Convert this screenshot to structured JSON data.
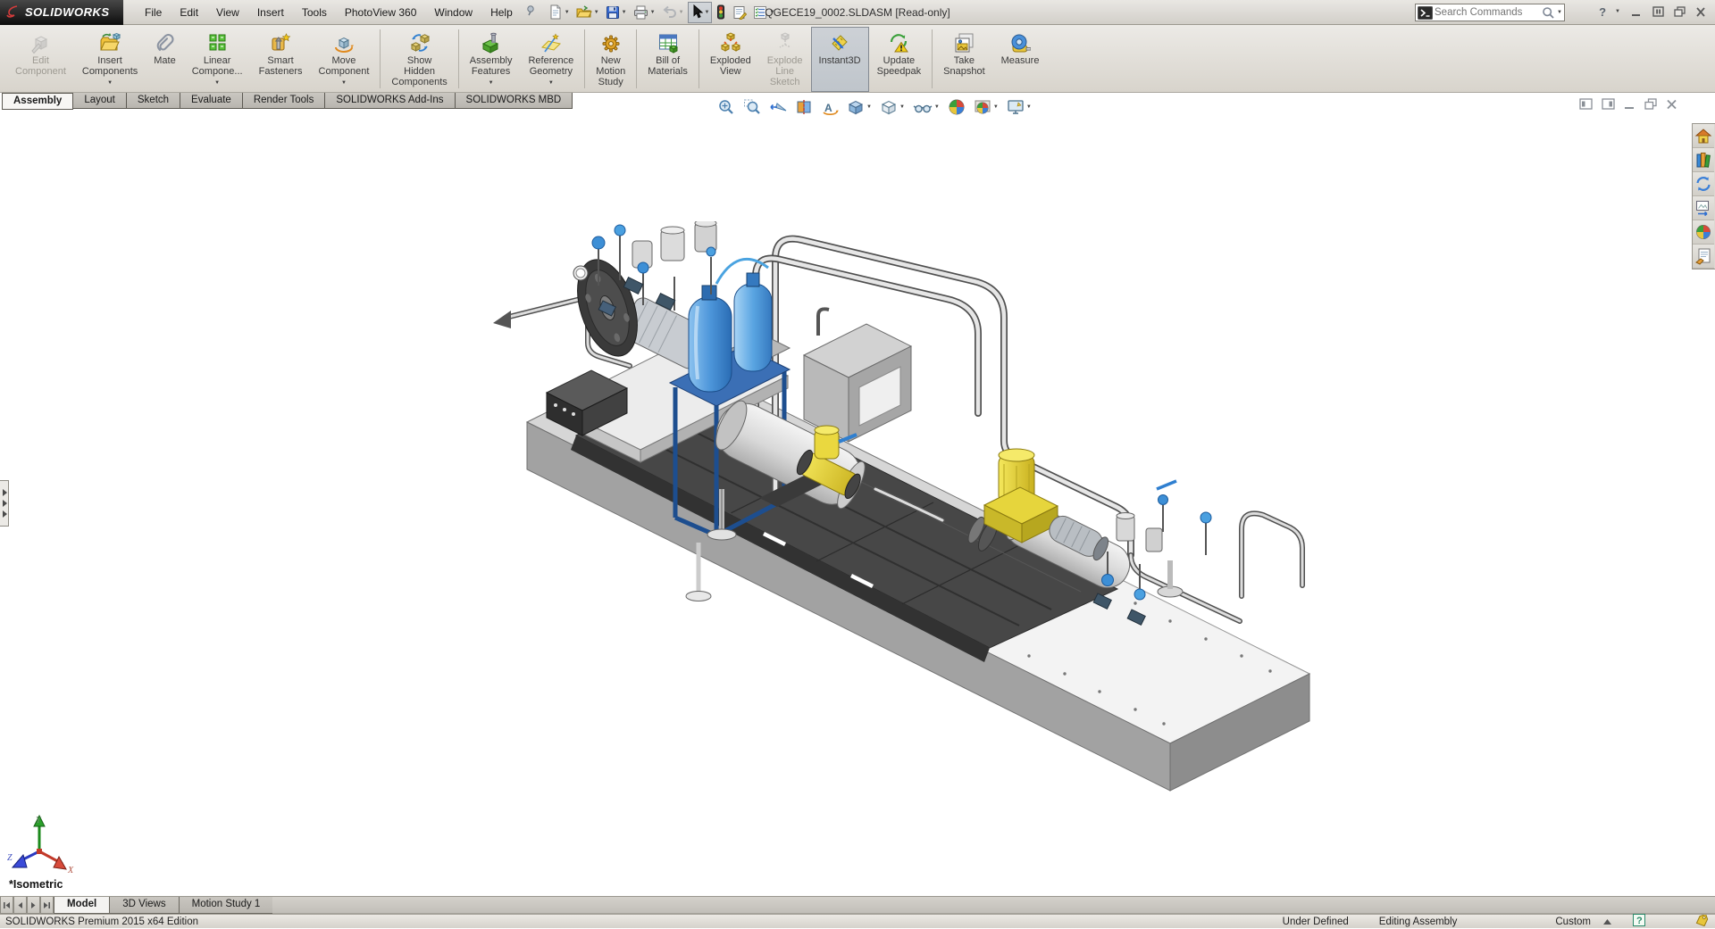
{
  "title_bar": {
    "logo_text": "SOLIDWORKS",
    "menus": [
      "File",
      "Edit",
      "View",
      "Insert",
      "Tools",
      "PhotoView 360",
      "Window",
      "Help"
    ],
    "document_title": "QGECE19_0002.SLDASM [Read-only]",
    "search_placeholder": "Search Commands",
    "quick_tools": [
      "new-document",
      "open",
      "save",
      "print",
      "undo",
      "select",
      "rebuild",
      "file-properties",
      "options"
    ]
  },
  "ribbon": {
    "buttons": [
      {
        "label": "Edit\nComponent",
        "state": "disabled"
      },
      {
        "label": "Insert\nComponents",
        "dropdown": true
      },
      {
        "label": "Mate"
      },
      {
        "label": "Linear\nCompone...",
        "dropdown": true
      },
      {
        "label": "Smart\nFasteners"
      },
      {
        "label": "Move\nComponent",
        "dropdown": true
      },
      {
        "label": "Show\nHidden\nComponents"
      },
      {
        "label": "Assembly\nFeatures",
        "dropdown": true
      },
      {
        "label": "Reference\nGeometry",
        "dropdown": true
      },
      {
        "label": "New\nMotion\nStudy"
      },
      {
        "label": "Bill of\nMaterials"
      },
      {
        "label": "Exploded\nView"
      },
      {
        "label": "Explode\nLine\nSketch",
        "state": "disabled"
      },
      {
        "label": "Instant3D",
        "state": "active"
      },
      {
        "label": "Update\nSpeedpak"
      },
      {
        "label": "Take\nSnapshot"
      },
      {
        "label": "Measure"
      }
    ]
  },
  "command_tabs": [
    {
      "label": "Assembly",
      "active": true
    },
    {
      "label": "Layout"
    },
    {
      "label": "Sketch"
    },
    {
      "label": "Evaluate"
    },
    {
      "label": "Render Tools"
    },
    {
      "label": "SOLIDWORKS Add-Ins"
    },
    {
      "label": "SOLIDWORKS MBD"
    }
  ],
  "viewport": {
    "view_label": "*Isometric",
    "triad_axes": {
      "x": "X",
      "y": "Y",
      "z": "Z"
    },
    "headsup_tools": [
      "zoom-to-fit",
      "zoom-to-area",
      "previous-view",
      "section-view",
      "3d-drawing-view",
      "view-orientation",
      "display-style",
      "hide-show-items",
      "edit-appearance",
      "apply-scene",
      "view-settings"
    ],
    "taskpane_tools": [
      "solidworks-resources",
      "design-library",
      "file-explorer",
      "view-palette",
      "appearances-scenes",
      "custom-properties"
    ]
  },
  "bottom_tabs": {
    "items": [
      {
        "label": "Model",
        "active": true
      },
      {
        "label": "3D Views"
      },
      {
        "label": "Motion Study 1"
      }
    ]
  },
  "status_bar": {
    "edition": "SOLIDWORKS Premium 2015 x64 Edition",
    "constraint_status": "Under Defined",
    "mode": "Editing Assembly",
    "config": "Custom"
  }
}
